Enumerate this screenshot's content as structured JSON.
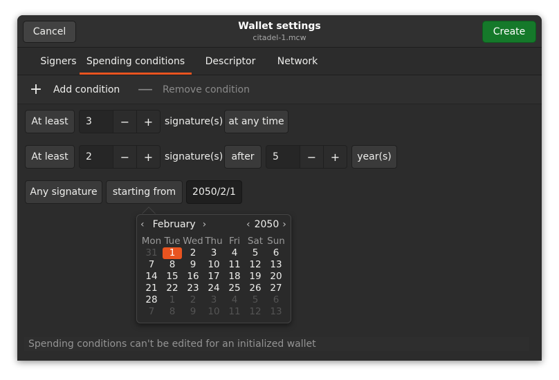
{
  "header": {
    "cancel_label": "Cancel",
    "title": "Wallet settings",
    "subtitle": "citadel-1.mcw",
    "create_label": "Create",
    "accent_color": "#15792a"
  },
  "tabs": [
    {
      "label": "Signers",
      "active": false
    },
    {
      "label": "Spending conditions",
      "active": true
    },
    {
      "label": "Descriptor",
      "active": false
    },
    {
      "label": "Network",
      "active": false
    }
  ],
  "tab_accent_color": "#e95420",
  "actions": {
    "add_icon": "plus-icon",
    "add_label": "Add condition",
    "remove_icon": "minus-icon",
    "remove_label": "Remove condition"
  },
  "conditions": [
    {
      "quantifier": "At least",
      "count": "3",
      "unit": "signature(s)",
      "timing": "at any time"
    },
    {
      "quantifier": "At least",
      "count": "2",
      "unit": "signature(s)",
      "timing": "after",
      "period_value": "5",
      "period_unit": "year(s)"
    },
    {
      "quantifier": "Any signature",
      "timing": "starting from",
      "date": "2050/2/1"
    }
  ],
  "spin": {
    "minus": "−",
    "plus": "+"
  },
  "calendar": {
    "month": "February",
    "year": "2050",
    "prev": "‹",
    "next": "›",
    "weekdays": [
      "Mon",
      "Tue",
      "Wed",
      "Thu",
      "Fri",
      "Sat",
      "Sun"
    ],
    "days": [
      [
        "31",
        "1",
        "2",
        "3",
        "4",
        "5",
        "6"
      ],
      [
        "7",
        "8",
        "9",
        "10",
        "11",
        "12",
        "13"
      ],
      [
        "14",
        "15",
        "16",
        "17",
        "18",
        "19",
        "20"
      ],
      [
        "21",
        "22",
        "23",
        "24",
        "25",
        "26",
        "27"
      ],
      [
        "28",
        "1",
        "2",
        "3",
        "4",
        "5",
        "6"
      ],
      [
        "7",
        "8",
        "9",
        "10",
        "11",
        "12",
        "13"
      ]
    ],
    "selected_day": "1",
    "selected_color": "#e95420"
  },
  "footer": {
    "status": "Spending conditions can't be edited for an initialized wallet"
  }
}
